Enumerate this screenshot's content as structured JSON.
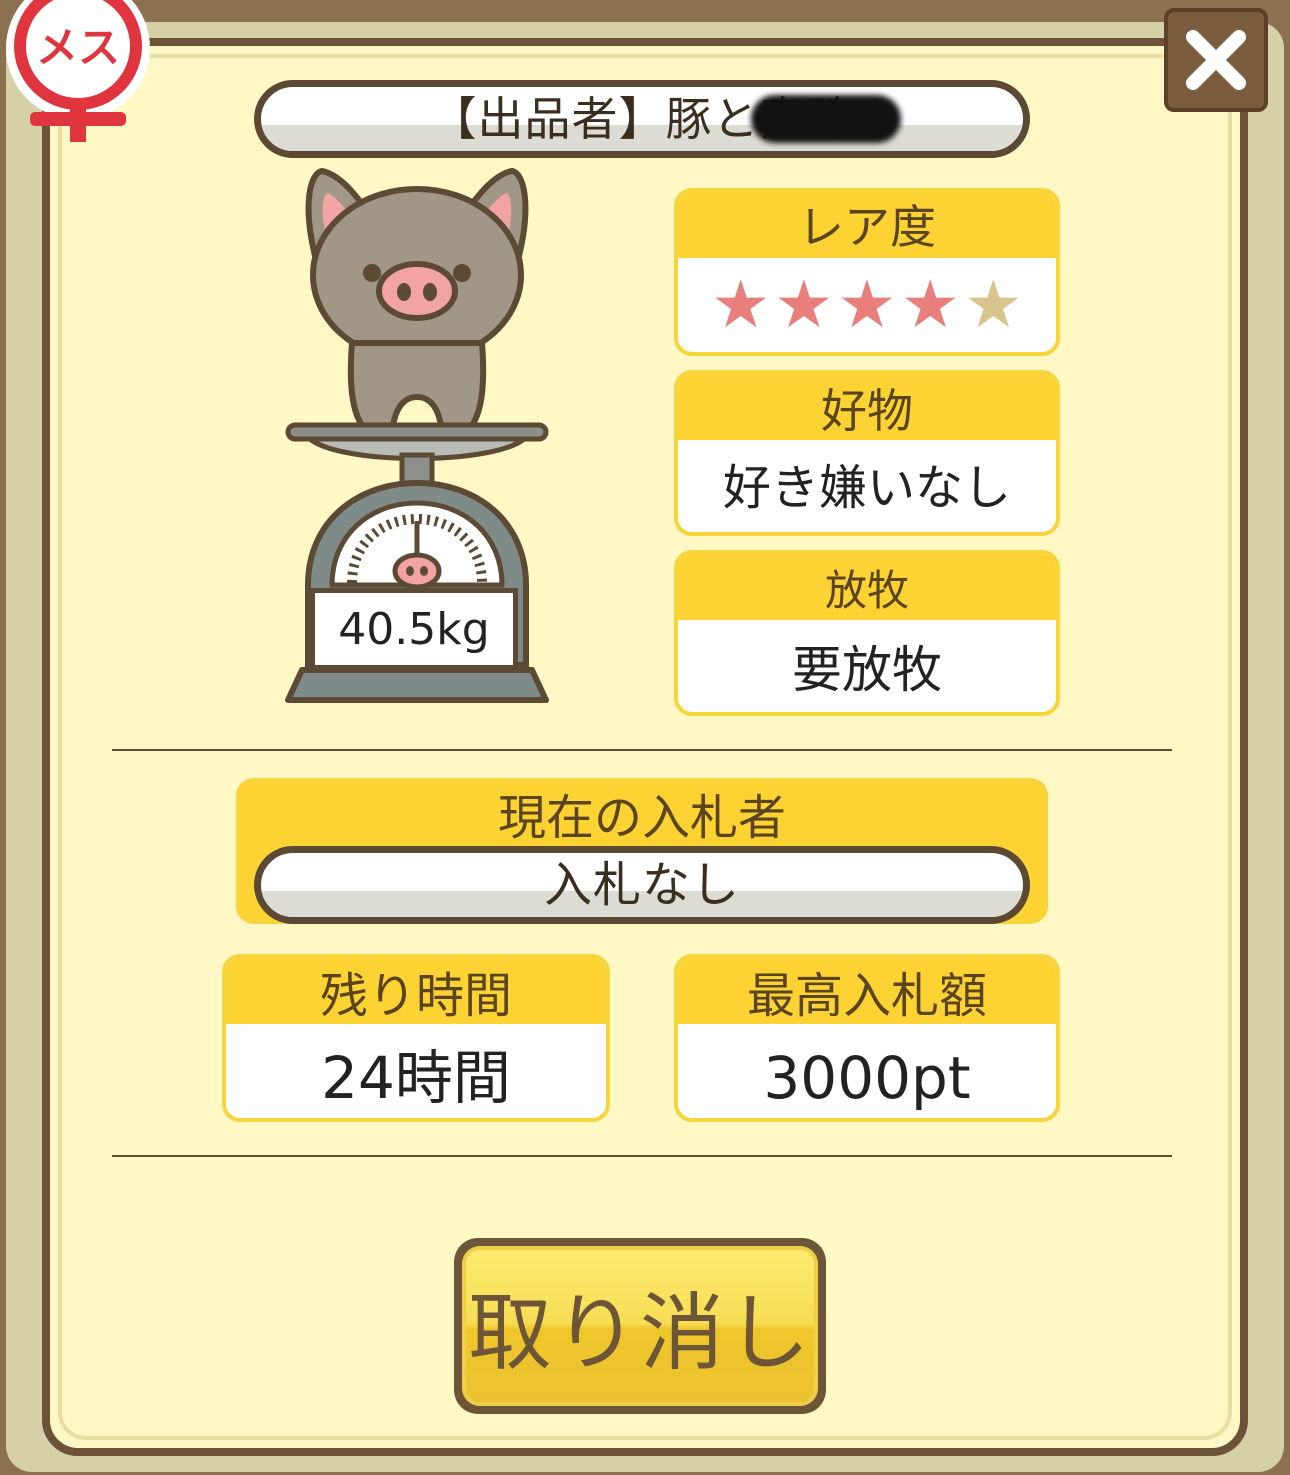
{
  "gender_badge": {
    "label": "メス",
    "icon": "female-symbol-icon"
  },
  "close_button": {
    "icon": "close-x-icon"
  },
  "seller": {
    "label": "【出品者】豚と真珠"
  },
  "weight": {
    "value": "40.5kg"
  },
  "rarity": {
    "label": "レア度",
    "filled_stars": 4,
    "max_stars": 5,
    "star_glyph": "★"
  },
  "favorite": {
    "label": "好物",
    "value": "好き嫌いなし"
  },
  "grazing": {
    "label": "放牧",
    "value": "要放牧"
  },
  "bidder": {
    "label": "現在の入札者",
    "value": "入札なし"
  },
  "remaining": {
    "label": "残り時間",
    "value": "24時間"
  },
  "highest_bid": {
    "label": "最高入札額",
    "value": "3000pt"
  },
  "cancel_button": {
    "label": "取り消し"
  },
  "colors": {
    "panel": "#fff8c4",
    "accent_yellow": "#fdd334",
    "frame_brown": "#6b5239",
    "star_filled": "#e87f7c",
    "star_empty": "#d8c48d",
    "badge_red": "#e0343f"
  }
}
